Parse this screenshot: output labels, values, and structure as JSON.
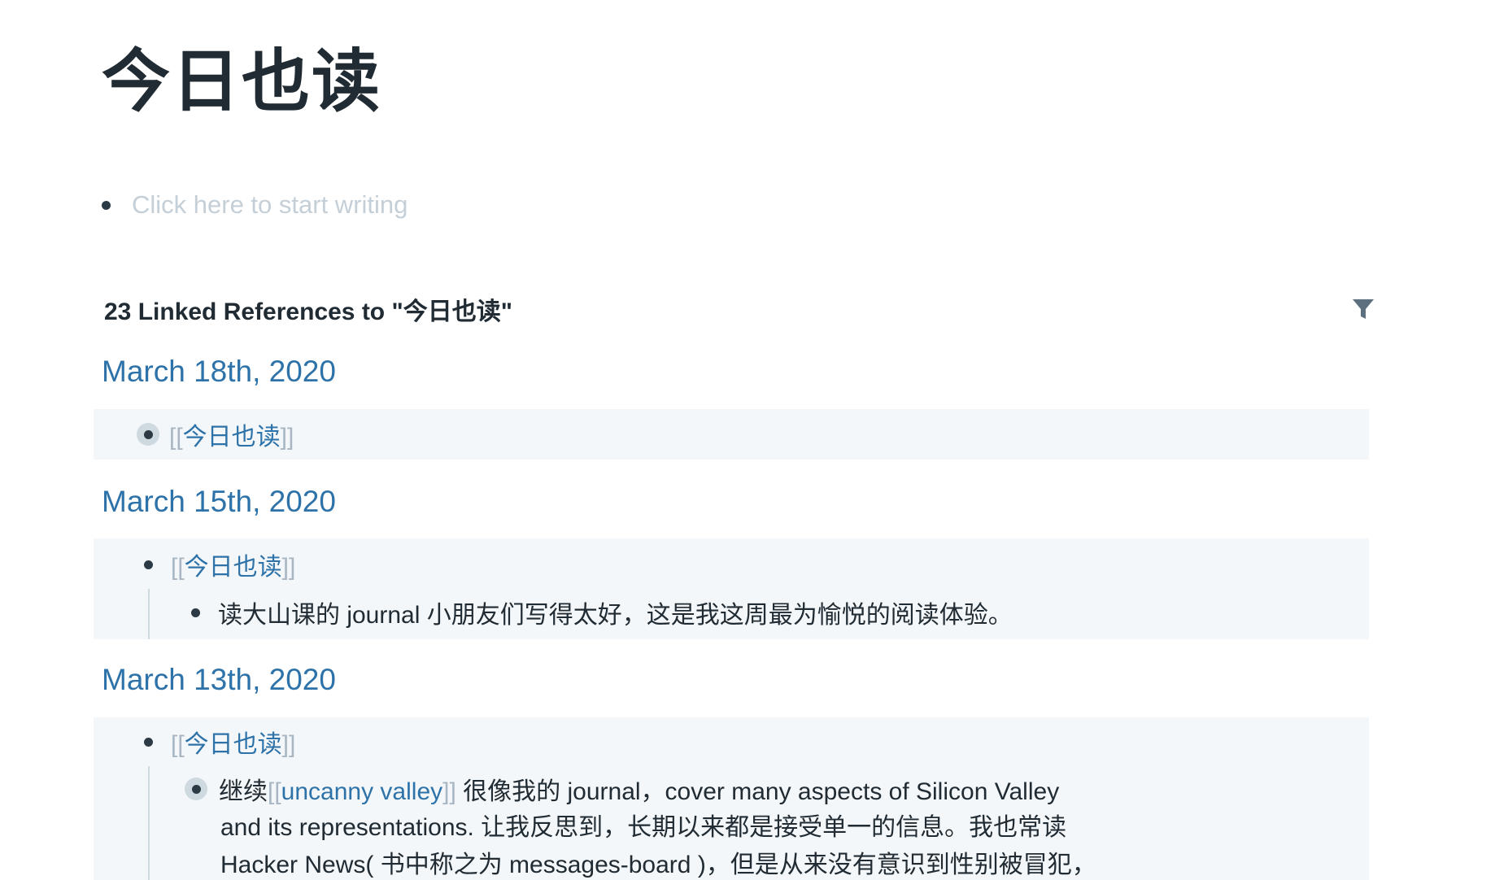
{
  "page": {
    "title": "今日也读",
    "placeholder": "Click here to start writing"
  },
  "references": {
    "header": "23 Linked References to \"今日也读\"",
    "filter_icon": "filter-icon",
    "groups": [
      {
        "date": "March 18th, 2020",
        "ref_open": "[[",
        "ref_text": "今日也读",
        "ref_close": "]]"
      },
      {
        "date": "March 15th, 2020",
        "ref_open": "[[",
        "ref_text": "今日也读",
        "ref_close": "]]",
        "child": "读大山课的 journal 小朋友们写得太好，这是我这周最为愉悦的阅读体验。"
      },
      {
        "date": "March 13th, 2020",
        "ref_open": "[[",
        "ref_text": "今日也读",
        "ref_close": "]]",
        "child_prefix": "继续",
        "child_ref_open": "[[",
        "child_ref_text": "uncanny valley",
        "child_ref_close": "]]",
        "child_line1": " 很像我的 journal，cover many aspects of Silicon Valley",
        "child_line2": "and its representations. 让我反思到，长期以来都是接受单一的信息。我也常读",
        "child_line3": "Hacker News( 书中称之为 messages-board )，但是从来没有意识到性别被冒犯，"
      }
    ]
  },
  "colors": {
    "link": "#2d72a8",
    "text": "#202b33",
    "placeholder": "#c5cfd7",
    "bracket": "#a7b6c2",
    "ref_background": "#f4f7f9"
  }
}
